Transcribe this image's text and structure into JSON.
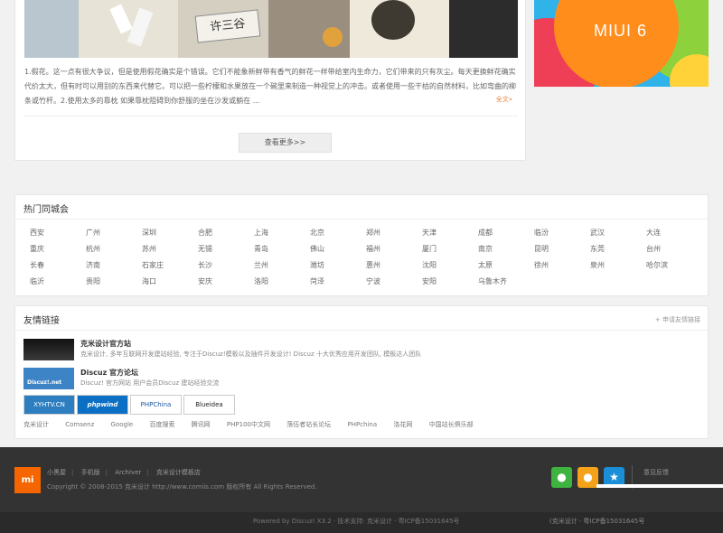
{
  "article": {
    "paragraph": "1.假花。这一点有很大争议，但是使用假花确实是个错误。它们不能象新鲜带有香气的鲜花一样带给室内生命力，它们带来的只有灰尘。每天更换鲜花确实代价太大，但有时可以用别的东西来代替它。可以把一些柠檬和水果放在一个碗里来制造一种视觉上的冲击。或者使用一些干枯的自然材料，比如弯曲的柳条或竹杆。2.使用太多的靠枕 如果靠枕阻碍到你舒服的坐在沙发或躺在 ...",
    "more": "全文»",
    "image_sign": "许三谷",
    "more_button": "查看更多>>"
  },
  "promo": {
    "logo": "MIUI 6"
  },
  "cities": {
    "title": "热门同城会",
    "items": [
      "西安",
      "广州",
      "深圳",
      "合肥",
      "上海",
      "北京",
      "郑州",
      "天津",
      "成都",
      "临汾",
      "武汉",
      "大连",
      "重庆",
      "杭州",
      "苏州",
      "无锡",
      "青岛",
      "佛山",
      "福州",
      "厦门",
      "南京",
      "昆明",
      "东莞",
      "台州",
      "长春",
      "济南",
      "石家庄",
      "长沙",
      "兰州",
      "潍坊",
      "惠州",
      "沈阳",
      "太原",
      "徐州",
      "泉州",
      "哈尔滨",
      "临沂",
      "贵阳",
      "海口",
      "安庆",
      "洛阳",
      "菏泽",
      "宁波",
      "安阳",
      "乌鲁木齐"
    ]
  },
  "links": {
    "title": "友情链接",
    "apply": "+ 申请友情链接",
    "rows": [
      {
        "name": "克米设计官方站",
        "desc": "克米设计, 多年互联网开发建站经验, 专注于Discuz!模板以及插件开发设计! Discuz 十大优秀应用开发团队, 模板达人团队"
      },
      {
        "name": "Discuz 官方论坛",
        "desc": "Discuz! 官方网站 用户会员Discuz 建站经验交流",
        "logo_text": "Discuz!.net"
      }
    ],
    "badges": [
      "XYHTV.CN",
      "phpwind",
      "PHPChina",
      "Blueidea"
    ],
    "text_links": [
      "克米设计",
      "Comsenz",
      "Google",
      "百度搜索",
      "腾讯网",
      "PHP100中文网",
      "落伍者站长论坛",
      "PHPchina",
      "洛花网",
      "中国站长俱乐部"
    ]
  },
  "footer": {
    "logo": "mi",
    "nav": [
      "小黑屋",
      "手机版",
      "Archiver",
      "克米设计模板店"
    ],
    "copyright": "Copyright © 2008-2015 克米设计 http://www.comiis.com 版权所有 All Rights Reserved.",
    "powered": "Powered by Discuz! X3.2 · 技术支持: 克米设计 · 粤ICP备15031645号",
    "icp": "(克米设计 · 粤ICP备15031645号",
    "feedback": "意见反馈"
  },
  "colors": {
    "accent": "#f56600",
    "link_more": "#e57f3c"
  }
}
